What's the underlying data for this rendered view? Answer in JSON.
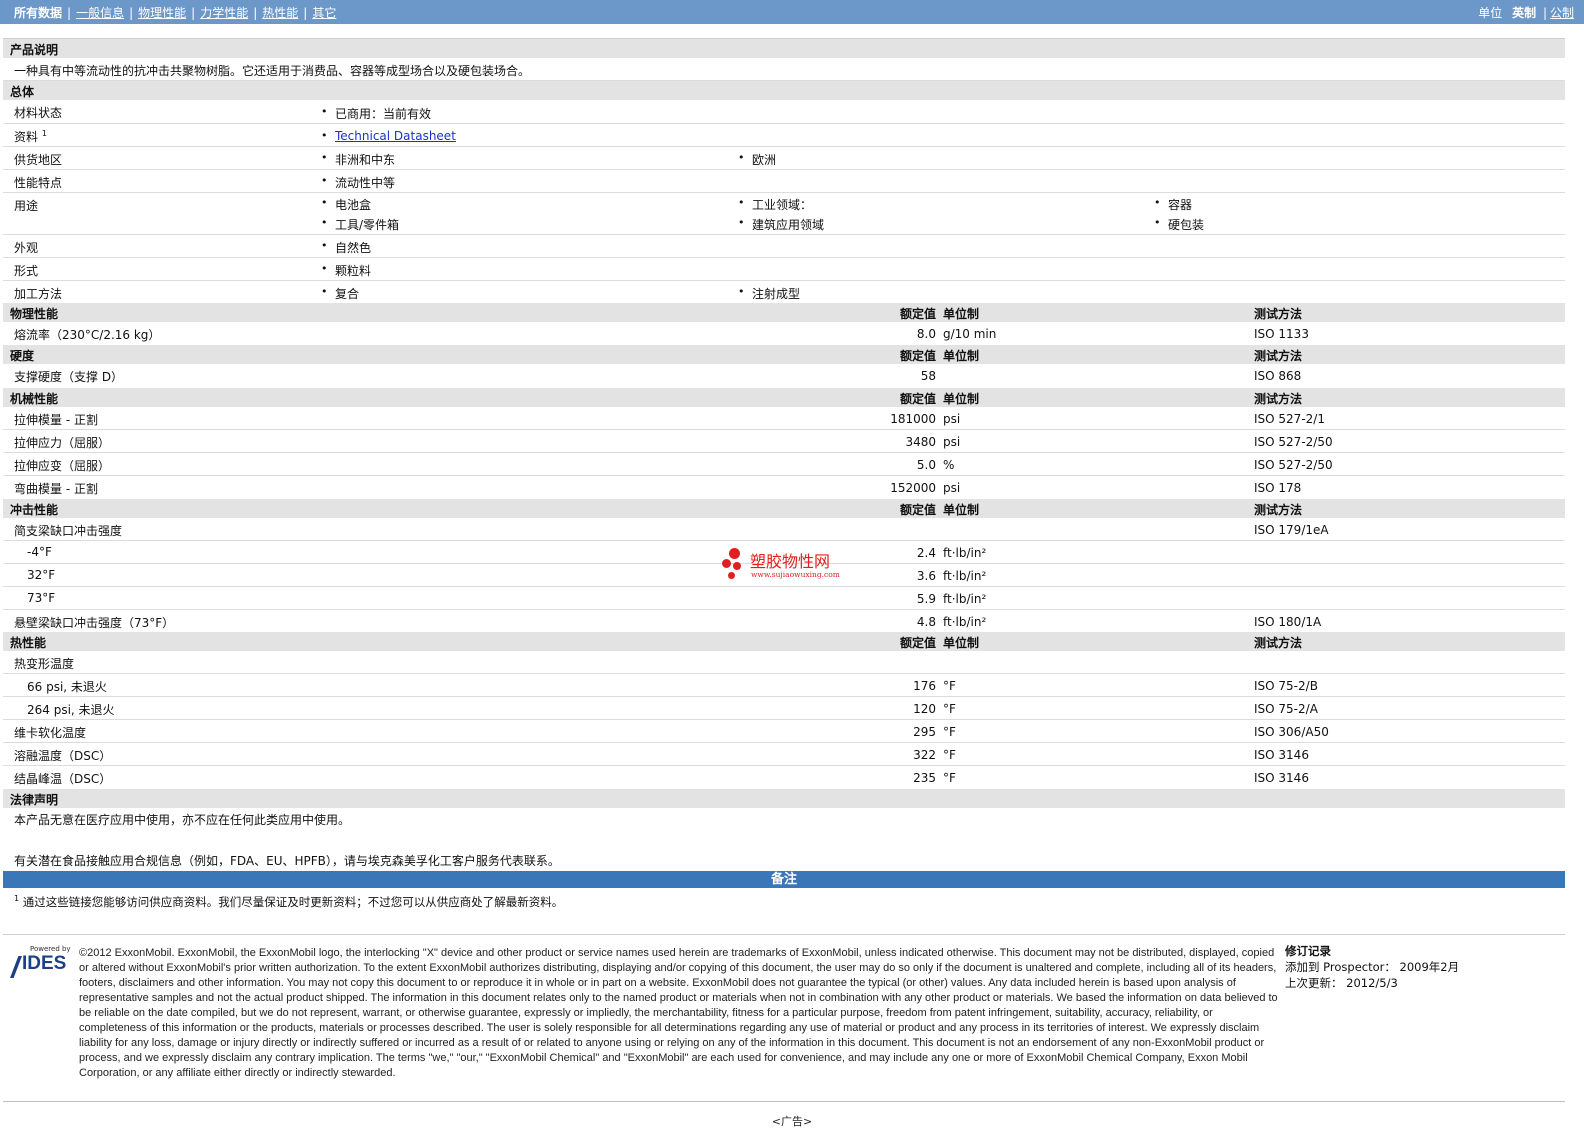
{
  "nav": {
    "items": [
      "所有数据",
      "一般信息",
      "物理性能",
      "力学性能",
      "热性能",
      "其它"
    ],
    "units_label": "单位",
    "units_imperial": "英制",
    "units_metric": "公制"
  },
  "description": {
    "title": "产品说明",
    "text": "一种具有中等流动性的抗冲击共聚物树脂。它还适用于消费品、容器等成型场合以及硬包装场合。"
  },
  "general": {
    "title": "总体",
    "material_status": {
      "label": "材料状态",
      "value": "已商用：当前有效"
    },
    "literature": {
      "label": "资料",
      "sup": "1",
      "value": "Technical Datasheet"
    },
    "availability": {
      "label": "供货地区",
      "values": [
        "非洲和中东",
        "欧洲"
      ]
    },
    "features": {
      "label": "性能特点",
      "value": "流动性中等"
    },
    "uses": {
      "label": "用途",
      "values": [
        "电池盒",
        "工业领域：",
        "容器",
        "工具/零件箱",
        "建筑应用领域",
        "硬包装"
      ]
    },
    "appearance": {
      "label": "外观",
      "value": "自然色"
    },
    "form": {
      "label": "形式",
      "value": "颗粒料"
    },
    "processing": {
      "label": "加工方法",
      "values": [
        "复合",
        "注射成型"
      ]
    }
  },
  "headers": {
    "nominal": "额定值",
    "unit": "单位制",
    "method": "测试方法"
  },
  "physical": {
    "title": "物理性能",
    "rows": [
      {
        "label": "熔流率（230°C/2.16 kg）",
        "value": "8.0",
        "unit": "g/10 min",
        "method": "ISO 1133"
      }
    ]
  },
  "hardness": {
    "title": "硬度",
    "rows": [
      {
        "label": "支撑硬度（支撑 D）",
        "value": "58",
        "unit": "",
        "method": "ISO 868"
      }
    ]
  },
  "mechanical": {
    "title": "机械性能",
    "rows": [
      {
        "label": "拉伸模量 - 正割",
        "value": "181000",
        "unit": "psi",
        "method": "ISO 527-2/1"
      },
      {
        "label": "拉伸应力（屈服）",
        "value": "3480",
        "unit": "psi",
        "method": "ISO 527-2/50"
      },
      {
        "label": "拉伸应变（屈服）",
        "value": "5.0",
        "unit": "%",
        "method": "ISO 527-2/50"
      },
      {
        "label": "弯曲模量 - 正割",
        "value": "152000",
        "unit": "psi",
        "method": "ISO 178"
      }
    ]
  },
  "impact": {
    "title": "冲击性能",
    "charpy": {
      "label": "简支梁缺口冲击强度",
      "method": "ISO 179/1eA"
    },
    "rows": [
      {
        "label": "-4°F",
        "value": "2.4",
        "unit": "ft·lb/in²"
      },
      {
        "label": "32°F",
        "value": "3.6",
        "unit": "ft·lb/in²"
      },
      {
        "label": "73°F",
        "value": "5.9",
        "unit": "ft·lb/in²"
      }
    ],
    "izod": {
      "label": "悬壁梁缺口冲击强度（73°F）",
      "value": "4.8",
      "unit": "ft·lb/in²",
      "method": "ISO 180/1A"
    }
  },
  "thermal": {
    "title": "热性能",
    "hdt": {
      "label": "热变形温度"
    },
    "hdt_rows": [
      {
        "label": "66 psi, 未退火",
        "value": "176",
        "unit": "°F",
        "method": "ISO 75-2/B"
      },
      {
        "label": "264 psi, 未退火",
        "value": "120",
        "unit": "°F",
        "method": "ISO 75-2/A"
      }
    ],
    "rows": [
      {
        "label": "维卡软化温度",
        "value": "295",
        "unit": "°F",
        "method": "ISO 306/A50"
      },
      {
        "label": "溶融温度（DSC）",
        "value": "322",
        "unit": "°F",
        "method": "ISO 3146"
      },
      {
        "label": "结晶峰温（DSC）",
        "value": "235",
        "unit": "°F",
        "method": "ISO 3146"
      }
    ]
  },
  "legal_section": {
    "title": "法律声明",
    "line1": "本产品无意在医疗应用中使用，亦不应在任何此类应用中使用。",
    "line2": "有关潜在食品接触应用合规信息（例如，FDA、EU、HPFB），请与埃克森美孚化工客户服务代表联系。"
  },
  "notes": {
    "title": "备注",
    "footnote_num": "1",
    "footnote": "通过这些链接您能够访问供应商资料。我们尽量保证及时更新资料；不过您可以从供应商处了解最新资料。"
  },
  "footer": {
    "logo_powered": "Powered by",
    "logo_text": "IDES",
    "legal": "©2012 ExxonMobil. ExxonMobil, the ExxonMobil logo, the interlocking \"X\" device and other product or service names used herein are trademarks of ExxonMobil, unless indicated otherwise. This document may not be distributed, displayed, copied or altered without ExxonMobil's prior written authorization. To the extent ExxonMobil authorizes distributing, displaying and/or copying of this document, the user may do so only if the document is unaltered and complete, including all of its headers, footers, disclaimers and other information. You may not copy this document to or reproduce it in whole or in part on a website. ExxonMobil does not guarantee the typical (or other) values. Any data included herein is based upon analysis of representative samples and not the actual product shipped. The information in this document relates only to the named product or materials when not in combination with any other product or materials. We based the information on data believed to be reliable on the date compiled, but we do not represent, warrant, or otherwise guarantee, expressly or impliedly, the merchantability, fitness for a particular purpose, freedom from patent infringement, suitability, accuracy, reliability, or completeness of this information or the products, materials or processes described. The user is solely responsible for all determinations regarding any use of material or product and any process in its territories of interest. We expressly disclaim liability for any loss, damage or injury directly or indirectly suffered or incurred as a result of or related to anyone using or relying on any of the information in this document. This document is not an endorsement of any non-ExxonMobil product or process, and we expressly disclaim any contrary implication. The terms \"we,\" \"our,\" \"ExxonMobil Chemical\" and \"ExxonMobil\" are each used for convenience, and may include any one or more of ExxonMobil Chemical Company, Exxon Mobil Corporation, or any affiliate either directly or indirectly stewarded.",
    "rev_title": "修订记录",
    "rev_added": "添加到 Prospector： 2009年2月",
    "rev_updated": "上次更新： 2012/5/3",
    "ad": "<广告>"
  },
  "watermark": {
    "text": "塑胶物性网",
    "url": "www.sujiaowuxing.com",
    "color": "#e02020"
  }
}
